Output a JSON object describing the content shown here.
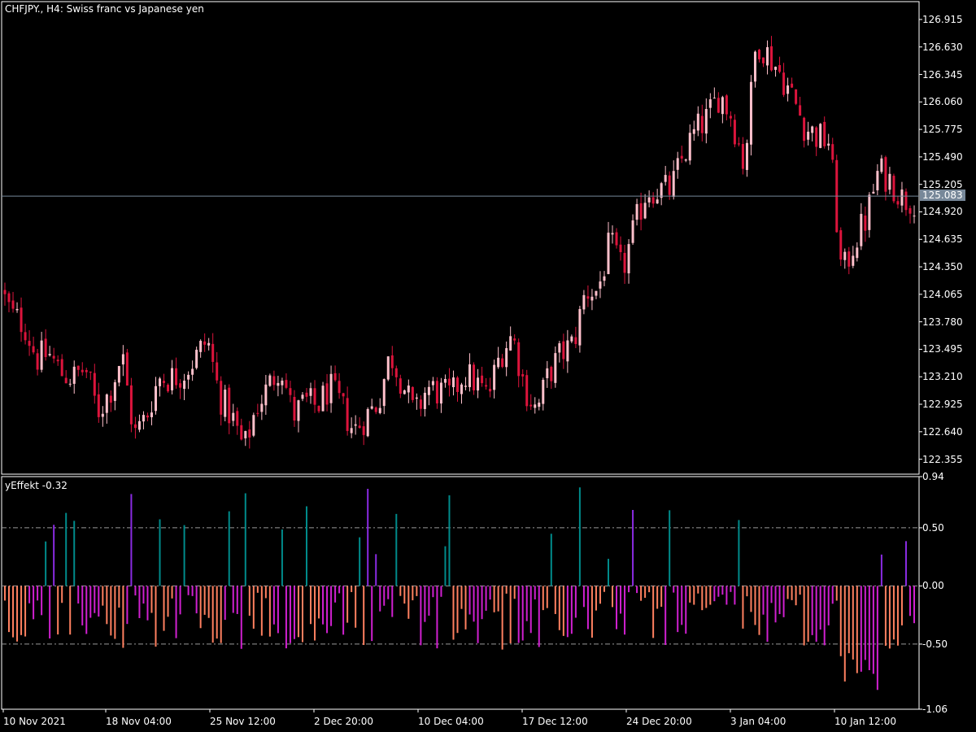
{
  "chart": {
    "symbol_line": "CHFJPY., H4:  Swiss franc vs Japanese yen",
    "price_ticks": [
      "126.915",
      "126.630",
      "126.345",
      "126.060",
      "125.775",
      "125.490",
      "125.205",
      "124.920",
      "124.635",
      "124.350",
      "124.065",
      "123.780",
      "123.495",
      "123.210",
      "122.925",
      "122.640",
      "122.355"
    ],
    "current_price": "125.083",
    "time_ticks": [
      "10 Nov 2021",
      "18 Nov 04:00",
      "25 Nov 12:00",
      "2 Dec 20:00",
      "10 Dec 04:00",
      "17 Dec 12:00",
      "24 Dec 20:00",
      "3 Jan 04:00",
      "10 Jan 12:00"
    ]
  },
  "indicator": {
    "label": "yEffekt -0.32",
    "ticks": [
      "0.94",
      "0.50",
      "0.00",
      "-0.50",
      "-1.06"
    ],
    "levels": [
      0.5,
      0.0,
      -0.5
    ]
  },
  "colors": {
    "background": "#000000",
    "frame": "#ffffff",
    "bull_candle": "#ffc0cb",
    "bear_candle": "#dc143c",
    "hist_pos_a": "#008b8b",
    "hist_pos_b": "#8a2be2",
    "hist_neg_a": "#ff8060",
    "hist_neg_b": "#d020d0",
    "price_line": "#778899"
  },
  "chart_data": [
    {
      "type": "candlestick",
      "title": "CHFJPY., H4:  Swiss franc vs Japanese yen",
      "ylim": [
        122.2,
        127.1
      ],
      "close_path": [
        [
          0,
          124.12
        ],
        [
          15,
          123.85
        ],
        [
          30,
          123.75
        ],
        [
          45,
          123.4
        ],
        [
          60,
          123.45
        ],
        [
          75,
          123.25
        ],
        [
          90,
          123.2
        ],
        [
          105,
          123.3
        ],
        [
          120,
          122.85
        ],
        [
          135,
          123.05
        ],
        [
          150,
          123.45
        ],
        [
          165,
          122.6
        ],
        [
          180,
          122.8
        ],
        [
          195,
          123.2
        ],
        [
          210,
          123.2
        ],
        [
          225,
          123.25
        ],
        [
          240,
          123.4
        ],
        [
          255,
          123.6
        ],
        [
          270,
          123.0
        ],
        [
          285,
          122.8
        ],
        [
          300,
          122.45
        ],
        [
          315,
          122.9
        ],
        [
          330,
          123.1
        ],
        [
          345,
          123.35
        ],
        [
          360,
          122.8
        ],
        [
          375,
          122.95
        ],
        [
          390,
          122.9
        ],
        [
          405,
          123.1
        ],
        [
          420,
          122.9
        ],
        [
          435,
          122.65
        ],
        [
          450,
          122.8
        ],
        [
          465,
          122.95
        ],
        [
          480,
          123.45
        ],
        [
          495,
          123.15
        ],
        [
          510,
          122.8
        ],
        [
          525,
          123.1
        ],
        [
          540,
          123.05
        ],
        [
          555,
          123.0
        ],
        [
          570,
          123.25
        ],
        [
          585,
          123.15
        ],
        [
          600,
          123.0
        ],
        [
          615,
          123.45
        ],
        [
          630,
          123.65
        ],
        [
          645,
          123.1
        ],
        [
          660,
          122.85
        ],
        [
          675,
          123.25
        ],
        [
          690,
          123.45
        ],
        [
          705,
          123.55
        ],
        [
          720,
          124.1
        ],
        [
          735,
          124.1
        ],
        [
          750,
          124.6
        ],
        [
          765,
          124.3
        ],
        [
          780,
          124.75
        ],
        [
          795,
          125.15
        ],
        [
          810,
          125.15
        ],
        [
          825,
          125.15
        ],
        [
          840,
          125.5
        ],
        [
          855,
          125.75
        ],
        [
          870,
          125.9
        ],
        [
          885,
          126.15
        ],
        [
          900,
          125.9
        ],
        [
          915,
          125.4
        ],
        [
          930,
          126.7
        ],
        [
          945,
          126.55
        ],
        [
          960,
          126.35
        ],
        [
          975,
          126.1
        ],
        [
          990,
          125.8
        ],
        [
          1005,
          125.7
        ],
        [
          1020,
          125.65
        ],
        [
          1035,
          124.25
        ],
        [
          1050,
          124.6
        ],
        [
          1065,
          124.85
        ],
        [
          1080,
          125.35
        ],
        [
          1095,
          125.25
        ],
        [
          1110,
          125.05
        ],
        [
          1122,
          125.05
        ]
      ],
      "current_price": 125.083
    },
    {
      "type": "bar",
      "title": "yEffekt -0.32",
      "ylim": [
        -1.06,
        0.94
      ],
      "levels": [
        0.5,
        0.0,
        -0.5
      ],
      "current_value": -0.32,
      "bar_count": 224
    }
  ]
}
